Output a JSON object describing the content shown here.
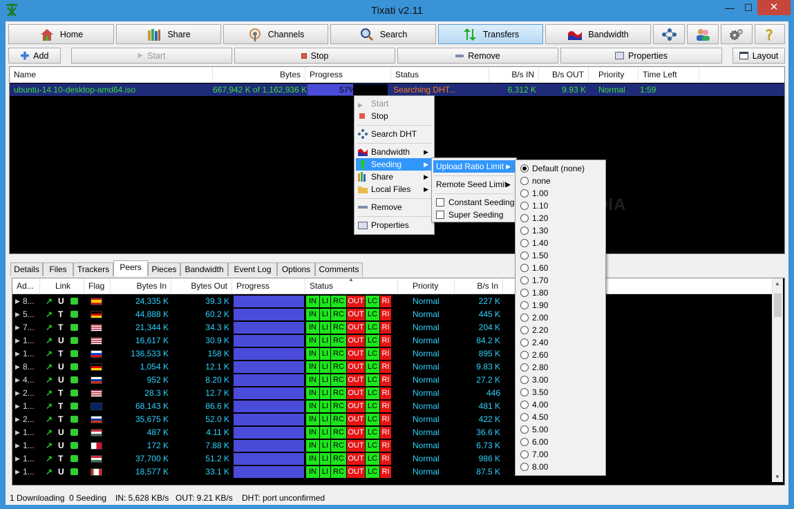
{
  "window": {
    "title": "Tixati v2.11",
    "min": "—",
    "max": "☐",
    "close": "✕"
  },
  "nav": [
    {
      "label": "Home",
      "icon": "home-icon"
    },
    {
      "label": "Share",
      "icon": "share-icon"
    },
    {
      "label": "Channels",
      "icon": "channels-icon"
    },
    {
      "label": "Search",
      "icon": "search-icon"
    },
    {
      "label": "Transfers",
      "icon": "transfers-icon"
    },
    {
      "label": "Bandwidth",
      "icon": "bandwidth-icon"
    }
  ],
  "toolbar": {
    "add": "Add",
    "start": "Start",
    "stop": "Stop",
    "remove": "Remove",
    "properties": "Properties",
    "layout": "Layout"
  },
  "transfers": {
    "headers": {
      "name": "Name",
      "bytes": "Bytes",
      "progress": "Progress",
      "status": "Status",
      "bps_in": "B/s IN",
      "bps_out": "B/s OUT",
      "priority": "Priority",
      "time_left": "Time Left"
    },
    "row": {
      "name": "ubuntu-14.10-desktop-amd64.iso",
      "bytes": "667,942 K of 1,162,936 K",
      "progress_text": "57%",
      "progress": 0.57,
      "status": "Searching DHT...",
      "bps_in": "6,312 K",
      "bps_out": "9.93 K",
      "priority": "Normal",
      "time_left": "1:59"
    }
  },
  "context_menu": {
    "start": "Start",
    "stop": "Stop",
    "search_dht": "Search DHT",
    "bandwidth": "Bandwidth",
    "seeding": "Seeding",
    "share": "Share",
    "local_files": "Local Files",
    "remove": "Remove",
    "properties": "Properties"
  },
  "seeding_menu": {
    "upload_ratio_limit": "Upload Ratio Limit",
    "remote_seed_limit": "Remote Seed Limit",
    "constant_seeding": "Constant Seeding",
    "super_seeding": "Super Seeding"
  },
  "ratio_options": [
    "Default (none)",
    "none",
    "1.00",
    "1.10",
    "1.20",
    "1.30",
    "1.40",
    "1.50",
    "1.60",
    "1.70",
    "1.80",
    "1.90",
    "2.00",
    "2.20",
    "2.40",
    "2.60",
    "2.80",
    "3.00",
    "3.50",
    "4.00",
    "4.50",
    "5.00",
    "6.00",
    "7.00",
    "8.00"
  ],
  "ratio_selected": 0,
  "watermark": "SOFTPEDIA",
  "tabs": [
    "Details",
    "Files",
    "Trackers",
    "Peers",
    "Pieces",
    "Bandwidth",
    "Event Log",
    "Options",
    "Comments"
  ],
  "tabs_active": 3,
  "peers": {
    "headers": {
      "address": "Ad...",
      "link": "Link",
      "flag": "Flag",
      "bytes_in": "Bytes In",
      "bytes_out": "Bytes Out",
      "progress": "Progress",
      "status": "Status",
      "priority": "Priority",
      "bps_in": "B/s In"
    },
    "status_labels": [
      "IN",
      "LI",
      "RC",
      "OUT",
      "LC",
      "RI"
    ],
    "rows": [
      {
        "addr": "8...",
        "link": "U",
        "flag": "es",
        "bytes_in": "24,335 K",
        "bytes_out": "39.3 K",
        "priority": "Normal",
        "bps_in": "227 K"
      },
      {
        "addr": "5...",
        "link": "T",
        "flag": "de",
        "bytes_in": "44,888 K",
        "bytes_out": "60.2 K",
        "priority": "Normal",
        "bps_in": "445 K"
      },
      {
        "addr": "7...",
        "link": "T",
        "flag": "us",
        "bytes_in": "21,344 K",
        "bytes_out": "34.3 K",
        "priority": "Normal",
        "bps_in": "204 K"
      },
      {
        "addr": "1...",
        "link": "U",
        "flag": "us",
        "bytes_in": "16,617 K",
        "bytes_out": "30.9 K",
        "priority": "Normal",
        "bps_in": "84.2 K"
      },
      {
        "addr": "1...",
        "link": "T",
        "flag": "si",
        "bytes_in": "136,533 K",
        "bytes_out": "158 K",
        "priority": "Normal",
        "bps_in": "895 K"
      },
      {
        "addr": "8...",
        "link": "U",
        "flag": "de",
        "bytes_in": "1,054 K",
        "bytes_out": "12.1 K",
        "priority": "Normal",
        "bps_in": "9.83 K"
      },
      {
        "addr": "4...",
        "link": "U",
        "flag": "ru",
        "bytes_in": "952 K",
        "bytes_out": "8.20 K",
        "priority": "Normal",
        "bps_in": "27.2 K"
      },
      {
        "addr": "2...",
        "link": "T",
        "flag": "us",
        "bytes_in": "28.3 K",
        "bytes_out": "12.7 K",
        "priority": "Normal",
        "bps_in": "446"
      },
      {
        "addr": "1...",
        "link": "T",
        "flag": "gb",
        "bytes_in": "68,143 K",
        "bytes_out": "86.6 K",
        "priority": "Normal",
        "bps_in": "481 K"
      },
      {
        "addr": "2...",
        "link": "T",
        "flag": "ru",
        "bytes_in": "35,675 K",
        "bytes_out": "52.0 K",
        "priority": "Normal",
        "bps_in": "422 K"
      },
      {
        "addr": "1...",
        "link": "U",
        "flag": "hu",
        "bytes_in": "487 K",
        "bytes_out": "4.11 K",
        "priority": "Normal",
        "bps_in": "36.6 K"
      },
      {
        "addr": "1...",
        "link": "U",
        "flag": "pa",
        "bytes_in": "172 K",
        "bytes_out": "7.88 K",
        "priority": "Normal",
        "bps_in": "6.73 K"
      },
      {
        "addr": "1...",
        "link": "T",
        "flag": "hu",
        "bytes_in": "37,700 K",
        "bytes_out": "51.2 K",
        "priority": "Normal",
        "bps_in": "986 K"
      },
      {
        "addr": "1...",
        "link": "U",
        "flag": "ca",
        "bytes_in": "18,577 K",
        "bytes_out": "33.1 K",
        "priority": "Normal",
        "bps_in": "87.5 K"
      }
    ]
  },
  "statusbar": {
    "downloading": "1 Downloading",
    "seeding": "0 Seeding",
    "in": "IN: 5,628 KB/s",
    "out": "OUT: 9.21 KB/s",
    "dht": "DHT: port unconfirmed"
  }
}
